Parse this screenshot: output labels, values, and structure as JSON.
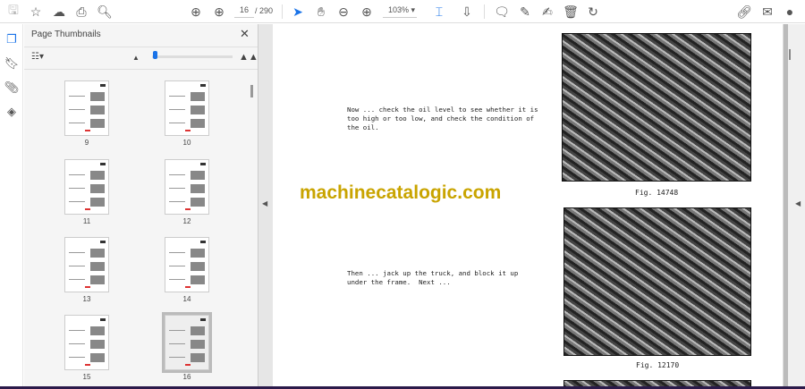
{
  "toolbar": {
    "current_page": "16",
    "total_pages": "/ 290",
    "zoom": "103%"
  },
  "sidebar": {
    "title": "Page Thumbnails",
    "close": "✕",
    "thumbnails": [
      {
        "label": "9"
      },
      {
        "label": "10"
      },
      {
        "label": "11"
      },
      {
        "label": "12"
      },
      {
        "label": "13"
      },
      {
        "label": "14"
      },
      {
        "label": "15"
      },
      {
        "label": "16",
        "selected": true
      }
    ]
  },
  "document": {
    "paragraph1": "Now ... check the oil level to see whether it is\ntoo high or too low, and check the condition of\nthe oil.",
    "paragraph2": "Then ... jack up the truck, and block it up\nunder the frame.  Next ...",
    "watermark": "machinecatalogic.com",
    "caption1": "Fig. 14748",
    "caption2": "Fig. 12170"
  },
  "colors": {
    "accent": "#1a73e8",
    "watermark": "#c9a400"
  }
}
